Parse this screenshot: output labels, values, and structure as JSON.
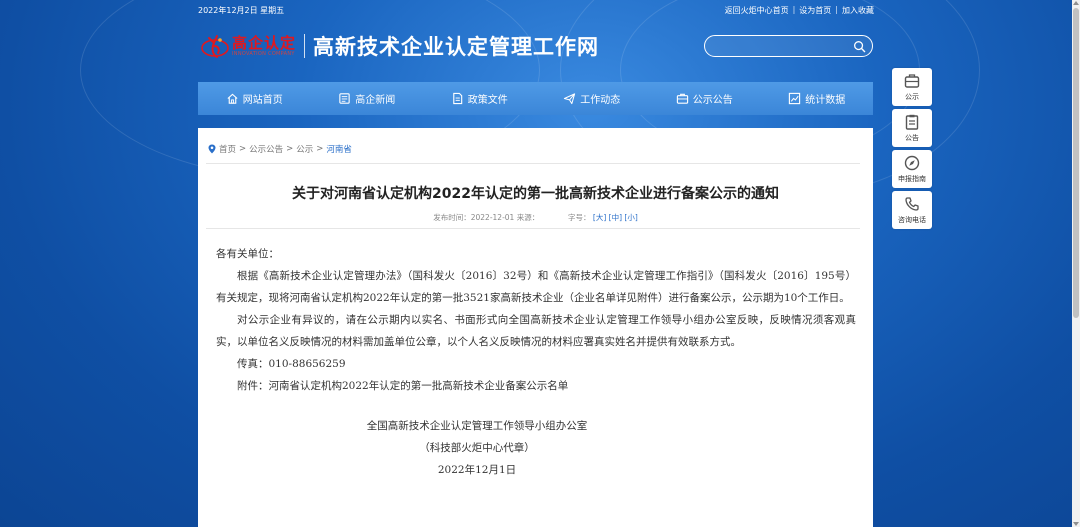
{
  "topbar": {
    "date": "2022年12月2日 星期五",
    "links": [
      "返回火炬中心首页",
      "设为首页",
      "加入收藏"
    ],
    "separator": "|"
  },
  "logo": {
    "brand_cn": "高企认定",
    "brand_en": "INNOVATION COMPANY",
    "site_title": "高新技术企业认定管理工作网"
  },
  "search": {
    "value": "",
    "placeholder": ""
  },
  "nav": [
    {
      "label": "网站首页",
      "icon": "home-icon"
    },
    {
      "label": "高企新闻",
      "icon": "news-icon"
    },
    {
      "label": "政策文件",
      "icon": "document-icon"
    },
    {
      "label": "工作动态",
      "icon": "paper-plane-icon"
    },
    {
      "label": "公示公告",
      "icon": "notice-icon"
    },
    {
      "label": "统计数据",
      "icon": "chart-icon"
    }
  ],
  "side": [
    {
      "label": "公示",
      "icon": "briefcase-icon"
    },
    {
      "label": "公告",
      "icon": "clipboard-icon"
    },
    {
      "label": "申报指南",
      "icon": "compass-icon"
    },
    {
      "label": "咨询电话",
      "icon": "phone-icon"
    }
  ],
  "breadcrumb": [
    "首页",
    "公示公告",
    "公示",
    "河南省"
  ],
  "breadcrumb_sep": ">",
  "article": {
    "title": "关于对河南省认定机构2022年认定的第一批高新技术企业进行备案公示的通知",
    "meta_time_label": "发布时间：2022-12-01 来源：",
    "meta_size_label": "字号：",
    "size_options": [
      "[大]",
      "[中]",
      "[小]"
    ],
    "salutation": "各有关单位：",
    "p1": "根据《高新技术企业认定管理办法》（国科发火〔2016〕32号）和《高新技术企业认定管理工作指引》（国科发火〔2016〕195号）有关规定，现将河南省认定机构2022年认定的第一批3521家高新技术企业（企业名单详见附件）进行备案公示，公示期为10个工作日。",
    "p2": "对公示企业有异议的，请在公示期内以实名、书面形式向全国高新技术企业认定管理工作领导小组办公室反映，反映情况须客观真实，以单位名义反映情况的材料需加盖单位公章，以个人名义反映情况的材料应署真实姓名并提供有效联系方式。",
    "fax": "传真：010-88656259",
    "attachment": "附件：河南省认定机构2022年认定的第一批高新技术企业备案公示名单",
    "sig_org": "全国高新技术企业认定管理工作领导小组办公室",
    "sig_sub": "（科技部火炬中心代章）",
    "sig_date": "2022年12月1日"
  },
  "colors": {
    "nav": "#3b86d8",
    "link": "#2a6fc9",
    "brand_red": "#e0181f"
  }
}
